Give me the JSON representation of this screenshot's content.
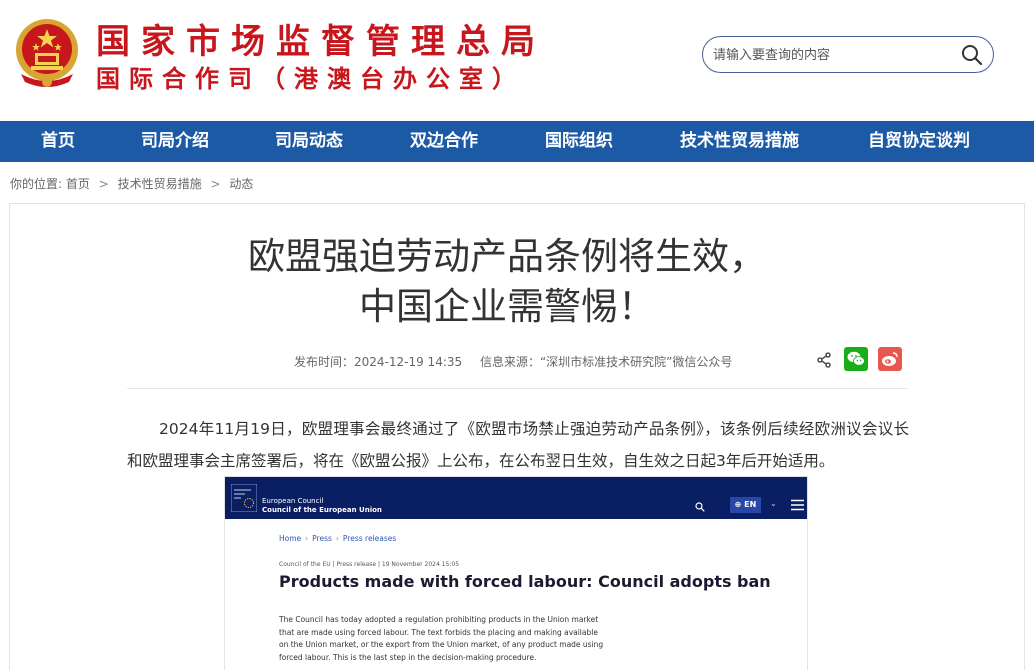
{
  "header": {
    "title": "国家市场监督管理总局",
    "subtitle": "国际合作司（港澳台办公室）",
    "search_placeholder": "请输入要查询的内容"
  },
  "nav": {
    "items": [
      "首页",
      "司局介绍",
      "司局动态",
      "双边合作",
      "国际组织",
      "技术性贸易措施",
      "自贸协定谈判"
    ]
  },
  "breadcrumb": {
    "prefix": "你的位置:",
    "items": [
      "首页",
      "技术性贸易措施",
      "动态"
    ],
    "separator": ">"
  },
  "article": {
    "title_line1": "欧盟强迫劳动产品条例将生效，",
    "title_line2": "中国企业需警惕！",
    "publish_time": "发布时间：2024-12-19 14:35",
    "source": "信息来源：“深圳市标准技术研究院”微信公众号",
    "paragraph": "2024年11月19日，欧盟理事会最终通过了《欧盟市场禁止强迫劳动产品条例》，该条例后续经欧洲议会议长和欧盟理事会主席签署后，将在《欧盟公报》上公布，在公布翌日生效，自生效之日起3年后开始适用。"
  },
  "embedded_screenshot": {
    "org_name": "European Council",
    "org_name2": "Council of the European Union",
    "lang": "EN",
    "crumbs": [
      "Home",
      "Press",
      "Press releases"
    ],
    "tag": "Council of the EU | Press release | 19 November 2024 15:05",
    "headline": "Products made with forced labour: Council adopts ban",
    "body": "The Council has today adopted a regulation prohibiting products in the Union market that are made using forced labour. The text forbids the placing and making available on the Union market, or the export from the Union market, of any product made using forced labour. This is the last step in the decision-making procedure."
  },
  "colors": {
    "brand_red": "#c8161d",
    "nav_blue": "#1d5aa6",
    "eu_navy": "#0a1e63",
    "wechat_green": "#19ad19",
    "weibo_red": "#e8574f"
  },
  "icons": [
    "national-emblem-icon",
    "search-icon",
    "share-icon",
    "wechat-icon",
    "weibo-icon",
    "eu-flag-icon",
    "menu-icon"
  ]
}
